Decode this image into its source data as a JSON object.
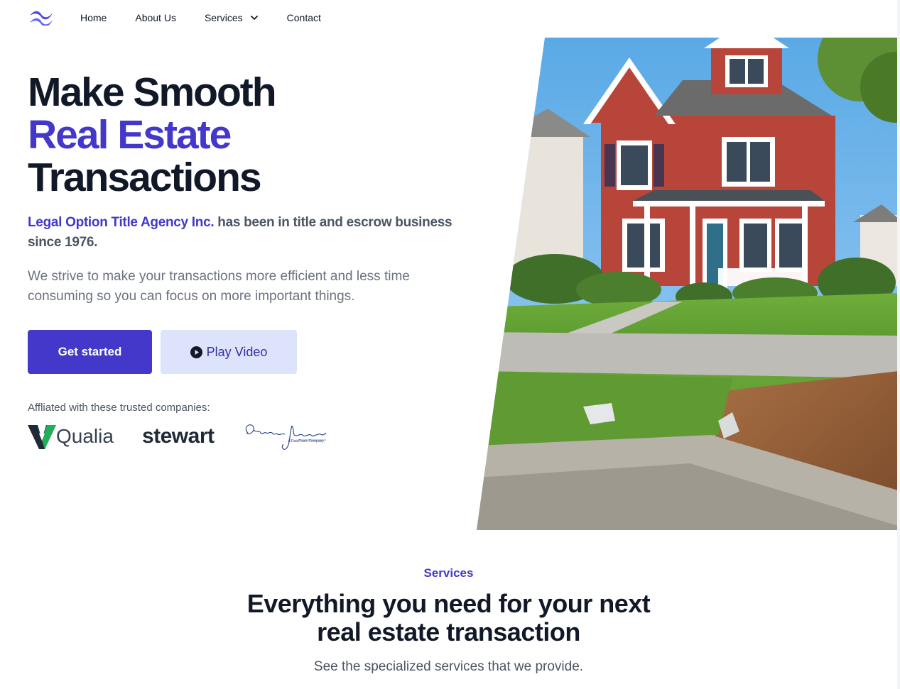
{
  "nav": {
    "logo_icon": "wave-logo-icon",
    "items": [
      {
        "label": "Home"
      },
      {
        "label": "About Us"
      },
      {
        "label": "Services",
        "icon": "chevron-down-icon"
      },
      {
        "label": "Contact"
      }
    ]
  },
  "hero": {
    "title_line1": "Make Smooth",
    "title_line2": "Real Estate",
    "title_line3": "Transactions",
    "lead_brand": "Legal Option Title Agency Inc.",
    "lead_rest": " has been in title and escrow business since 1976.",
    "subtext": "We strive to make your transactions more efficient and less time consuming so you can focus on more important things.",
    "primary_button": "Get started",
    "secondary_button": "Play Video",
    "affiliated_label": "Affliated with these trusted companies:",
    "partners": {
      "qualia": "Qualia",
      "stewart": "stewart",
      "charles_jones": "Charles Jones",
      "charles_jones_sub": "A DataTrace Company"
    }
  },
  "services": {
    "eyebrow": "Services",
    "title_line1": "Everything you need for your next",
    "title_line2": "real estate transaction",
    "subtitle": "See the specialized services that we provide."
  },
  "colors": {
    "accent": "#4338ca",
    "secondary_button_bg": "#dde3fa",
    "heading": "#111827",
    "body": "#4b5563"
  }
}
